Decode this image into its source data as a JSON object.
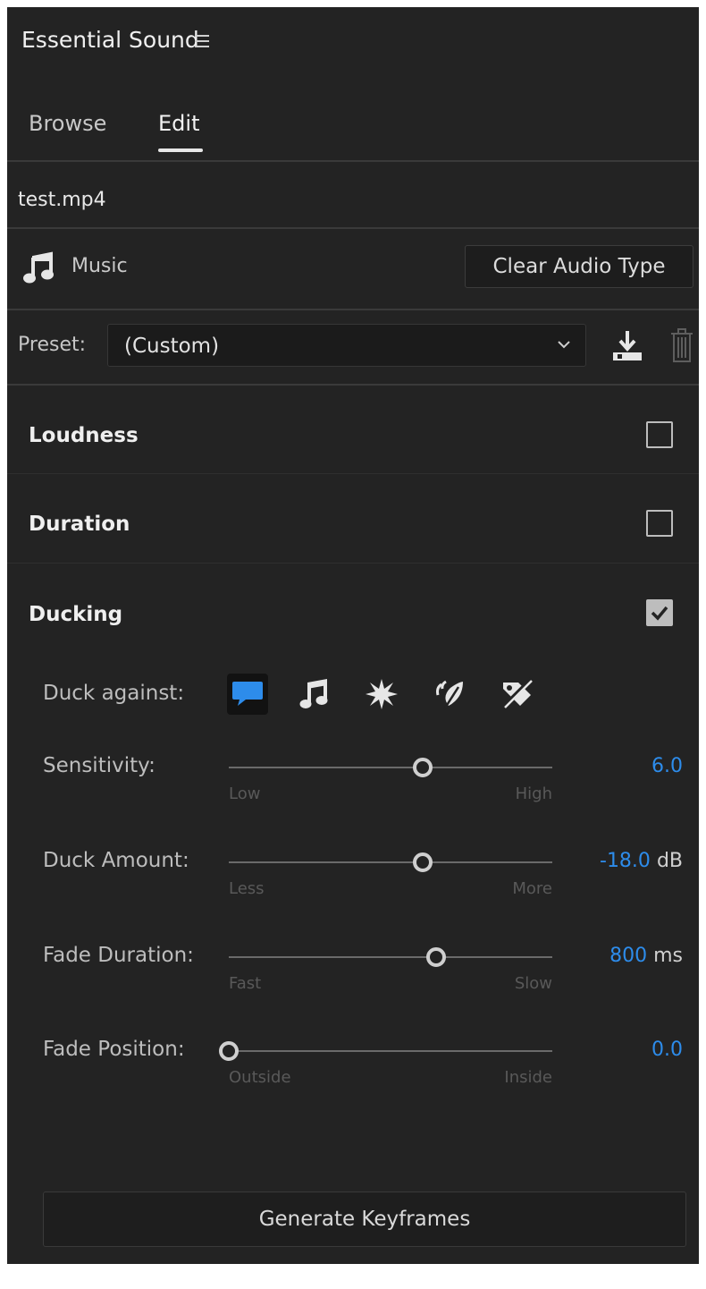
{
  "panel": {
    "title": "Essential Sound",
    "menu_icon": "hamburger-menu-icon"
  },
  "tabs": [
    {
      "label": "Browse",
      "active": false
    },
    {
      "label": "Edit",
      "active": true
    }
  ],
  "clip": {
    "filename": "test.mp4"
  },
  "audio_type": {
    "icon": "music-note-icon",
    "label": "Music",
    "clear_button": "Clear Audio Type"
  },
  "preset": {
    "label": "Preset:",
    "value": "(Custom)",
    "save_icon": "save-preset-icon",
    "delete_icon": "trash-icon"
  },
  "sections": {
    "loudness": {
      "title": "Loudness",
      "checked": false
    },
    "duration": {
      "title": "Duration",
      "checked": false
    },
    "ducking": {
      "title": "Ducking",
      "checked": true
    }
  },
  "ducking": {
    "duck_against_label": "Duck against:",
    "duck_against_icons": [
      {
        "name": "dialogue-icon",
        "selected": true
      },
      {
        "name": "music-icon",
        "selected": false
      },
      {
        "name": "sfx-icon",
        "selected": false
      },
      {
        "name": "ambience-icon",
        "selected": false
      },
      {
        "name": "unclassified-audio-icon",
        "selected": false
      }
    ],
    "sliders": [
      {
        "label": "Sensitivity:",
        "min_label": "Low",
        "max_label": "High",
        "value": "6.0",
        "unit": "",
        "position": 0.6
      },
      {
        "label": "Duck Amount:",
        "min_label": "Less",
        "max_label": "More",
        "value": "-18.0",
        "unit": "dB",
        "position": 0.6
      },
      {
        "label": "Fade Duration:",
        "min_label": "Fast",
        "max_label": "Slow",
        "value": "800",
        "unit": "ms",
        "position": 0.64
      },
      {
        "label": "Fade Position:",
        "min_label": "Outside",
        "max_label": "Inside",
        "value": "0.0",
        "unit": "",
        "position": 0.0
      }
    ],
    "generate_button": "Generate Keyframes"
  },
  "colors": {
    "background": "#232323",
    "accent": "#2d8ceb",
    "dialogue_icon": "#2d8ceb"
  }
}
